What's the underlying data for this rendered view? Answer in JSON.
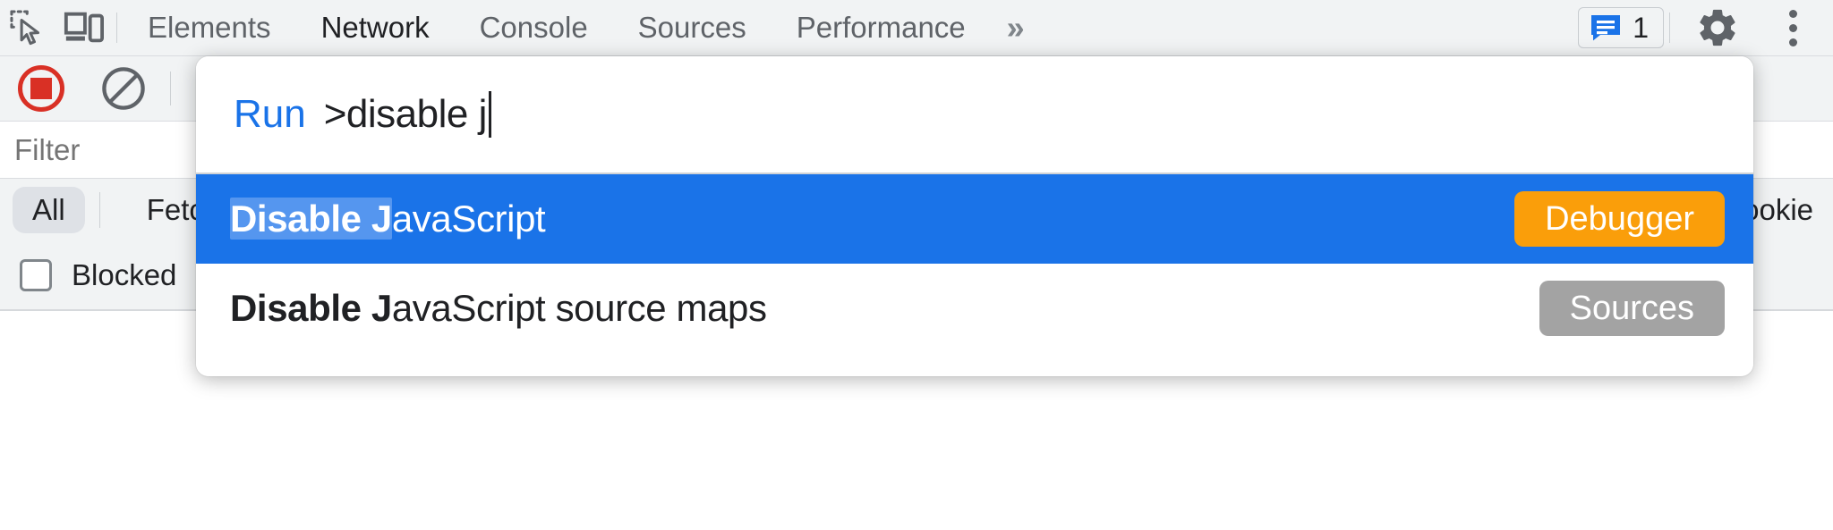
{
  "toolbar": {
    "inspect_icon": "inspect-element-icon",
    "device_icon": "device-toolbar-icon",
    "tabs": [
      {
        "label": "Elements",
        "selected": false
      },
      {
        "label": "Network",
        "selected": true
      },
      {
        "label": "Console",
        "selected": false
      },
      {
        "label": "Sources",
        "selected": false
      },
      {
        "label": "Performance",
        "selected": false
      }
    ],
    "more_tabs_label": "»",
    "message_icon": "console-message-icon",
    "message_count": "1",
    "settings_icon": "gear-icon",
    "menu_icon": "kebab-menu-icon"
  },
  "network_toolbar": {
    "record_icon": "record-stop-icon",
    "clear_icon": "clear-network-log-icon"
  },
  "filter_bar": {
    "filter_placeholder": "Filter",
    "filter_value": "",
    "types": [
      {
        "label": "All",
        "active": true
      },
      {
        "label": "Fetch",
        "active": false
      }
    ],
    "cookies_label": "ookie",
    "blocked_label": "Blocked",
    "blocked_checked": false
  },
  "palette": {
    "prefix": "Run",
    "query": ">disable j",
    "results": [
      {
        "match": "Disable J",
        "rest": "avaScript",
        "badge": "Debugger",
        "badge_color": "#fa9e0a",
        "selected": true
      },
      {
        "match": "Disable J",
        "rest": "avaScript source maps",
        "badge": "Sources",
        "badge_color": "#a3a3a3",
        "selected": false
      }
    ]
  },
  "colors": {
    "accent_blue": "#1a73e8",
    "highlight_blue": "#5596ef",
    "record_red": "#d93025",
    "chrome_bg": "#f1f3f4",
    "border": "#dadce0"
  }
}
